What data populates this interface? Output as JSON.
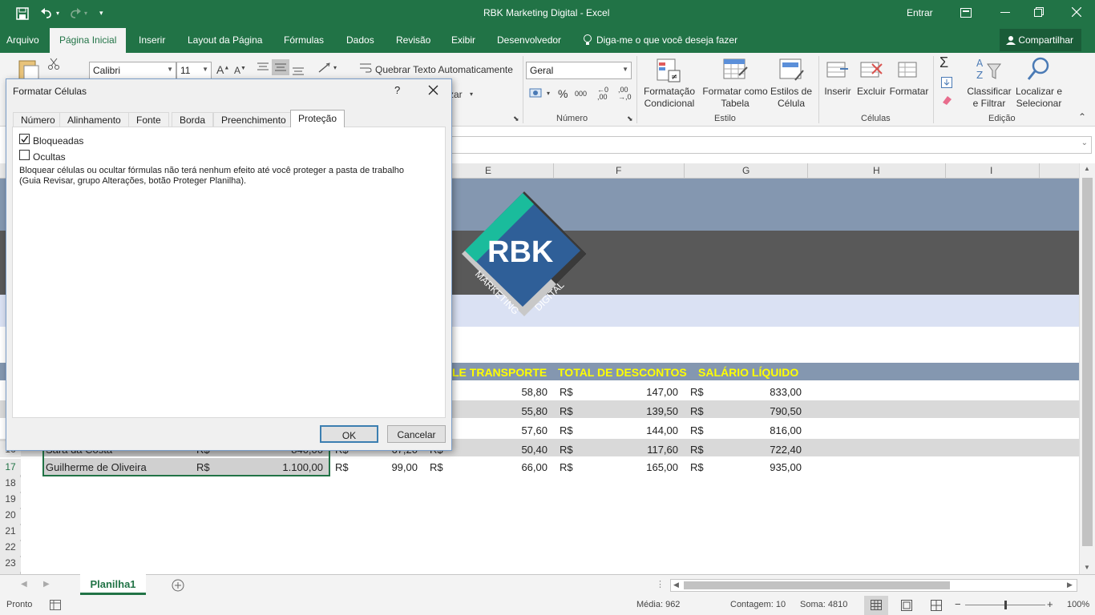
{
  "window": {
    "title": "RBK Marketing Digital  -  Excel",
    "signin": "Entrar"
  },
  "ribbon_tabs": [
    "Arquivo",
    "Página Inicial",
    "Inserir",
    "Layout da Página",
    "Fórmulas",
    "Dados",
    "Revisão",
    "Exibir",
    "Desenvolvedor"
  ],
  "tell_me": "Diga-me o que você deseja fazer",
  "share": "Compartilhar",
  "ribbon": {
    "font_name": "Calibri",
    "font_size": "11",
    "wrap_text": "Quebrar Texto Automaticamente",
    "merge_partial": "zar",
    "number_format": "Geral",
    "percent": "%",
    "thousands": "000",
    "group_numero": "Número",
    "group_estilo": "Estilo",
    "group_celulas": "Células",
    "group_edicao": "Edição",
    "cond_format_1": "Formatação",
    "cond_format_2": "Condicional",
    "format_table_1": "Formatar como",
    "format_table_2": "Tabela",
    "cell_styles_1": "Estilos de",
    "cell_styles_2": "Célula",
    "insert": "Inserir",
    "delete": "Excluir",
    "format": "Formatar",
    "sort_1": "Classificar",
    "sort_2": "e Filtrar",
    "find_1": "Localizar e",
    "find_2": "Selecionar"
  },
  "columns": [
    "E",
    "F",
    "G",
    "H",
    "I"
  ],
  "logo": {
    "text": "RBK",
    "sub1": "MARKETING",
    "sub2": "DIGITAL"
  },
  "table_headers": [
    "LE TRANSPORTE",
    "TOTAL DE DESCONTOS",
    "SALÁRIO LÍQUIDO"
  ],
  "rows": [
    {
      "transport": "58,80",
      "discounts": "147,00",
      "net": "833,00"
    },
    {
      "transport": "55,80",
      "discounts": "139,50",
      "net": "790,50"
    },
    {
      "transport": "57,60",
      "discounts": "144,00",
      "net": "816,00"
    },
    {
      "num": "16",
      "name": "Sara da Costa",
      "salary": "840,00",
      "col_d": "67,20",
      "transport": "50,40",
      "discounts": "117,60",
      "net": "722,40"
    },
    {
      "num": "17",
      "name": "Guilherme de Oliveira",
      "salary": "1.100,00",
      "col_d": "99,00",
      "transport": "66,00",
      "discounts": "165,00",
      "net": "935,00"
    }
  ],
  "currency": "R$",
  "empty_rows": [
    "18",
    "19",
    "20",
    "21",
    "22",
    "23"
  ],
  "sheet_tab": "Planilha1",
  "status": {
    "ready": "Pronto",
    "average": "Média: 962",
    "count": "Contagem: 10",
    "sum": "Soma: 4810",
    "zoom": "100%",
    "zoom_level": 0.5
  },
  "dialog": {
    "title": "Formatar Células",
    "help": "?",
    "tabs": [
      "Número",
      "Alinhamento",
      "Fonte",
      "Borda",
      "Preenchimento",
      "Proteção"
    ],
    "selected_tab": "Proteção",
    "locked_label": "Bloqueadas",
    "locked_checked": true,
    "hidden_label": "Ocultas",
    "hidden_checked": false,
    "note_line1": "Bloquear células ou ocultar fórmulas não terá nenhum efeito até você proteger a pasta de trabalho",
    "note_line2": "(Guia Revisar, grupo Alterações, botão Proteger Planilha).",
    "ok": "OK",
    "cancel": "Cancelar"
  },
  "colors": {
    "excel_green": "#217346",
    "header_band": "#8497b0",
    "dark_band": "#595959",
    "light_band": "#dae1f3",
    "header_text": "#ffff00",
    "logo_blue": "#2f5f98",
    "logo_teal": "#1abc9c"
  }
}
